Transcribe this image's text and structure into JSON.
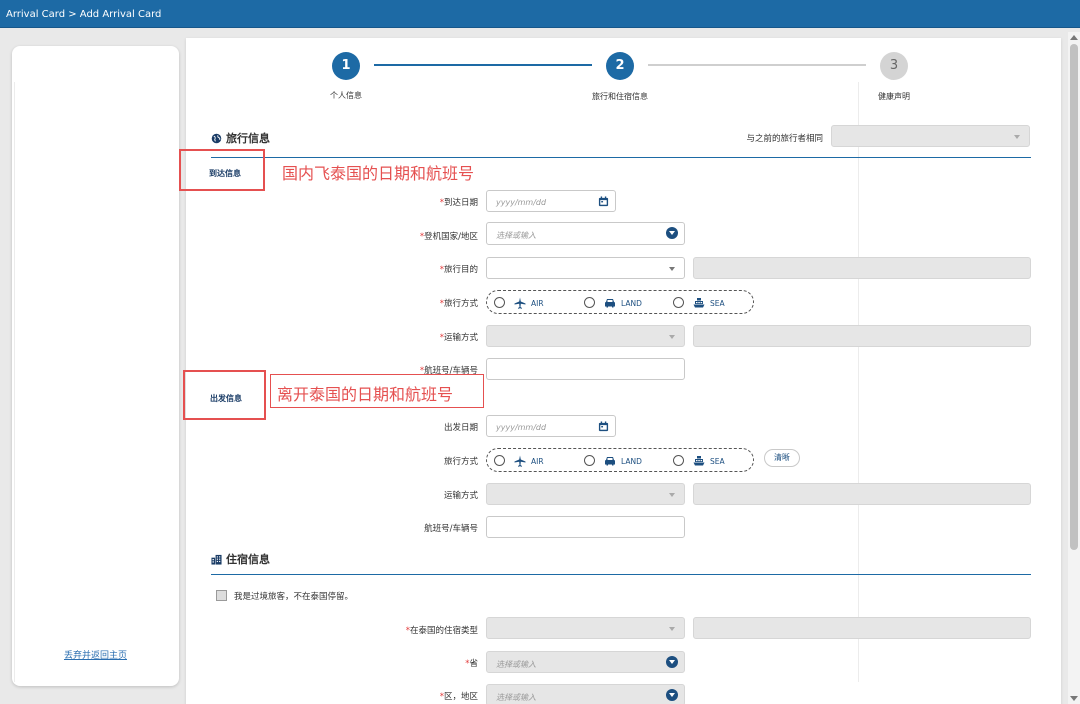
{
  "topbar": {
    "breadcrumb": "Arrival Card > Add Arrival Card"
  },
  "sidebar": {
    "home_link": "丢弃并返回主页"
  },
  "stepper": {
    "steps": [
      {
        "number": "1",
        "label": "个人信息",
        "state": "done"
      },
      {
        "number": "2",
        "label": "旅行和住宿信息",
        "state": "active"
      },
      {
        "number": "3",
        "label": "健康声明",
        "state": "pending"
      }
    ],
    "colors": {
      "active": "#1d6aa5",
      "inactive": "#d4d4d4"
    }
  },
  "travel": {
    "title": "旅行信息",
    "same_as_prev_label": "与之前的旅行者相同",
    "same_as_prev_value": "",
    "arrival": {
      "subtitle": "到达信息",
      "date_label": "到达日期",
      "date_placeholder": "yyyy/mm/dd",
      "boarding_label": "登机国家/地区",
      "boarding_placeholder": "选择或输入",
      "purpose_label": "旅行目的",
      "mode_label": "旅行方式",
      "transport_label": "运输方式",
      "flight_label": "航班号/车辆号"
    },
    "departure": {
      "subtitle": "出发信息",
      "date_label": "出发日期",
      "date_placeholder": "yyyy/mm/dd",
      "mode_label": "旅行方式",
      "clear_label": "清晰",
      "transport_label": "运输方式",
      "flight_label": "航班号/车辆号"
    },
    "modes": [
      "AIR",
      "LAND",
      "SEA"
    ]
  },
  "accommodation": {
    "title": "住宿信息",
    "transit_checkbox": "我是过境旅客，不在泰国停留。",
    "type_label": "在泰国的住宿类型",
    "province_label": "省",
    "province_placeholder": "选择或输入",
    "district_label": "区，地区",
    "district_placeholder": "选择或输入"
  },
  "annotations": {
    "arrival_note": "国内飞泰国的日期和航班号",
    "departure_note": "离开泰国的日期和航班号",
    "color": "#e55050"
  },
  "icons": [
    "globe-icon",
    "calendar-icon",
    "plane-icon",
    "car-icon",
    "ship-icon",
    "building-icon",
    "chevron-down-icon"
  ]
}
